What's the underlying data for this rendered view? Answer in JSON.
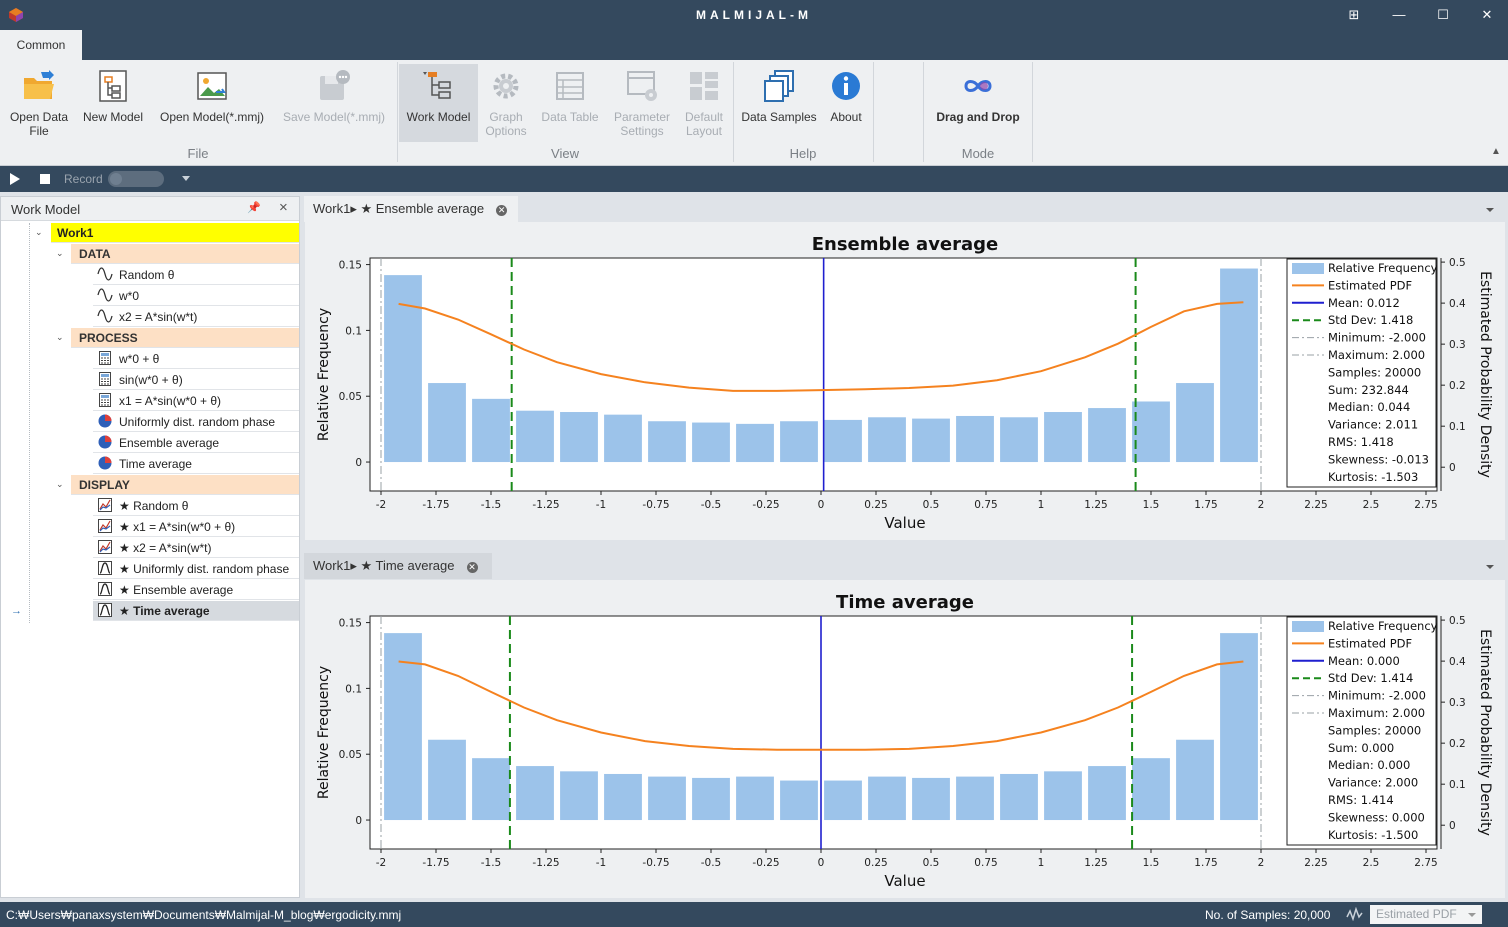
{
  "window": {
    "title": "MALMIJAL-M"
  },
  "ribbon": {
    "tab": "Common",
    "file": {
      "group": "File",
      "open_data_l1": "Open Data",
      "open_data_l2": "File",
      "new_model": "New Model",
      "open_model": "Open Model(*.mmj)",
      "save_model": "Save Model(*.mmj)"
    },
    "view": {
      "group": "View",
      "work_model": "Work Model",
      "graph_l1": "Graph",
      "graph_l2": "Options",
      "data_table": "Data Table",
      "param_l1": "Parameter",
      "param_l2": "Settings",
      "default_l1": "Default",
      "default_l2": "Layout"
    },
    "help": {
      "group": "Help",
      "data_samples": "Data Samples",
      "about": "About"
    },
    "mode": {
      "group": "Mode",
      "drag_drop": "Drag and Drop"
    }
  },
  "record": {
    "label": "Record"
  },
  "work_model": {
    "title": "Work Model",
    "root": "Work1",
    "data_header": "DATA",
    "data": [
      "Random θ",
      "w*0",
      "x2 = A*sin(w*t)"
    ],
    "process_header": "PROCESS",
    "process": [
      "w*0 + θ",
      "sin(w*0 + θ)",
      "x1 = A*sin(w*0 + θ)",
      "Uniformly dist. random phase",
      "Ensemble average",
      "Time average"
    ],
    "display_header": "DISPLAY",
    "display": [
      "★ Random θ",
      "★ x1 = A*sin(w*0 + θ)",
      "★ x2 = A*sin(w*t)",
      "★ Uniformly dist. random phase",
      "★ Ensemble average",
      "★ Time average"
    ]
  },
  "docs": [
    {
      "tab": "Work1▸ ★ Ensemble average"
    },
    {
      "tab": "Work1▸ ★ Time average"
    }
  ],
  "chart_data": [
    {
      "type": "bar",
      "title": "Ensemble average",
      "xlabel": "Value",
      "ylabel": "Relative Frequency",
      "y2label": "Estimated Probability Density",
      "xlim": [
        -2.05,
        2.8
      ],
      "ylim": [
        -0.022,
        0.155
      ],
      "y2lim": [
        -0.058,
        0.51
      ],
      "xticks": [
        "-2",
        "-1.75",
        "-1.5",
        "-1.25",
        "-1",
        "-0.75",
        "-0.5",
        "-0.25",
        "0",
        "0.25",
        "0.5",
        "0.75",
        "1",
        "1.25",
        "1.5",
        "1.75",
        "2",
        "2.25",
        "2.5",
        "2.75"
      ],
      "yticks": [
        "0",
        "0.05",
        "0.1",
        "0.15"
      ],
      "y2ticks": [
        "0",
        "0.1",
        "0.2",
        "0.3",
        "0.4",
        "0.5"
      ],
      "bar_centers": [
        -1.9,
        -1.7,
        -1.5,
        -1.3,
        -1.1,
        -0.9,
        -0.7,
        -0.5,
        -0.3,
        -0.1,
        0.1,
        0.3,
        0.5,
        0.7,
        0.9,
        1.1,
        1.3,
        1.5,
        1.7,
        1.9
      ],
      "values": [
        0.142,
        0.06,
        0.048,
        0.039,
        0.038,
        0.036,
        0.031,
        0.03,
        0.029,
        0.031,
        0.032,
        0.034,
        0.033,
        0.035,
        0.034,
        0.038,
        0.041,
        0.046,
        0.06,
        0.147
      ],
      "pdf_x": [
        -1.92,
        -1.8,
        -1.65,
        -1.5,
        -1.35,
        -1.2,
        -1.0,
        -0.8,
        -0.6,
        -0.4,
        -0.2,
        0.0,
        0.2,
        0.4,
        0.6,
        0.8,
        1.0,
        1.2,
        1.35,
        1.5,
        1.65,
        1.8,
        1.92
      ],
      "pdf_y": [
        0.398,
        0.387,
        0.36,
        0.324,
        0.287,
        0.256,
        0.227,
        0.207,
        0.194,
        0.186,
        0.186,
        0.188,
        0.19,
        0.193,
        0.199,
        0.212,
        0.234,
        0.268,
        0.301,
        0.342,
        0.38,
        0.398,
        0.402
      ],
      "mean": 0.012,
      "std": 1.418,
      "min": -2.0,
      "max": 2.0,
      "legend": {
        "relfreq": "Relative Frequency",
        "pdf": "Estimated PDF",
        "mean": "Mean: 0.012",
        "std": "Std Dev: 1.418",
        "min": "Minimum: -2.000",
        "max": "Maximum: 2.000",
        "samples": "Samples: 20000",
        "sum": "Sum: 232.844",
        "median": "Median: 0.044",
        "variance": "Variance: 2.011",
        "rms": "RMS: 1.418",
        "skew": "Skewness: -0.013",
        "kurt": "Kurtosis: -1.503"
      },
      "colors": {
        "bar": "#9cc3ea",
        "pdf": "#f5821f",
        "mean": "#1f1fcf",
        "std": "#1a8a1a",
        "minmax": "#9aa0a6"
      }
    },
    {
      "type": "bar",
      "title": "Time average",
      "xlabel": "Value",
      "ylabel": "Relative Frequency",
      "y2label": "Estimated Probability Density",
      "xlim": [
        -2.05,
        2.8
      ],
      "ylim": [
        -0.022,
        0.155
      ],
      "y2lim": [
        -0.058,
        0.51
      ],
      "xticks": [
        "-2",
        "-1.75",
        "-1.5",
        "-1.25",
        "-1",
        "-0.75",
        "-0.5",
        "-0.25",
        "0",
        "0.25",
        "0.5",
        "0.75",
        "1",
        "1.25",
        "1.5",
        "1.75",
        "2",
        "2.25",
        "2.5",
        "2.75"
      ],
      "yticks": [
        "0",
        "0.05",
        "0.1",
        "0.15"
      ],
      "y2ticks": [
        "0",
        "0.1",
        "0.2",
        "0.3",
        "0.4",
        "0.5"
      ],
      "bar_centers": [
        -1.9,
        -1.7,
        -1.5,
        -1.3,
        -1.1,
        -0.9,
        -0.7,
        -0.5,
        -0.3,
        -0.1,
        0.1,
        0.3,
        0.5,
        0.7,
        0.9,
        1.1,
        1.3,
        1.5,
        1.7,
        1.9
      ],
      "values": [
        0.142,
        0.061,
        0.047,
        0.041,
        0.037,
        0.035,
        0.033,
        0.032,
        0.033,
        0.03,
        0.03,
        0.033,
        0.032,
        0.033,
        0.035,
        0.037,
        0.041,
        0.047,
        0.061,
        0.142
      ],
      "pdf_x": [
        -1.92,
        -1.8,
        -1.65,
        -1.5,
        -1.35,
        -1.2,
        -1.0,
        -0.8,
        -0.6,
        -0.4,
        -0.2,
        0.0,
        0.2,
        0.4,
        0.6,
        0.8,
        1.0,
        1.2,
        1.35,
        1.5,
        1.65,
        1.8,
        1.92
      ],
      "pdf_y": [
        0.399,
        0.392,
        0.364,
        0.325,
        0.287,
        0.256,
        0.226,
        0.205,
        0.193,
        0.186,
        0.184,
        0.184,
        0.184,
        0.186,
        0.193,
        0.205,
        0.226,
        0.256,
        0.287,
        0.325,
        0.364,
        0.392,
        0.399
      ],
      "mean": 0.0,
      "std": 1.414,
      "min": -2.0,
      "max": 2.0,
      "legend": {
        "relfreq": "Relative Frequency",
        "pdf": "Estimated PDF",
        "mean": "Mean: 0.000",
        "std": "Std Dev: 1.414",
        "min": "Minimum: -2.000",
        "max": "Maximum: 2.000",
        "samples": "Samples: 20000",
        "sum": "Sum: 0.000",
        "median": "Median: 0.000",
        "variance": "Variance: 2.000",
        "rms": "RMS: 1.414",
        "skew": "Skewness: 0.000",
        "kurt": "Kurtosis: -1.500"
      },
      "colors": {
        "bar": "#9cc3ea",
        "pdf": "#f5821f",
        "mean": "#1f1fcf",
        "std": "#1a8a1a",
        "minmax": "#9aa0a6"
      }
    }
  ],
  "status": {
    "path": "C:₩Users₩panaxsystem₩Documents₩Malmijal-M_blog₩ergodicity.mmj",
    "samples": "No. of Samples: 20,000",
    "mode": "Estimated PDF"
  }
}
